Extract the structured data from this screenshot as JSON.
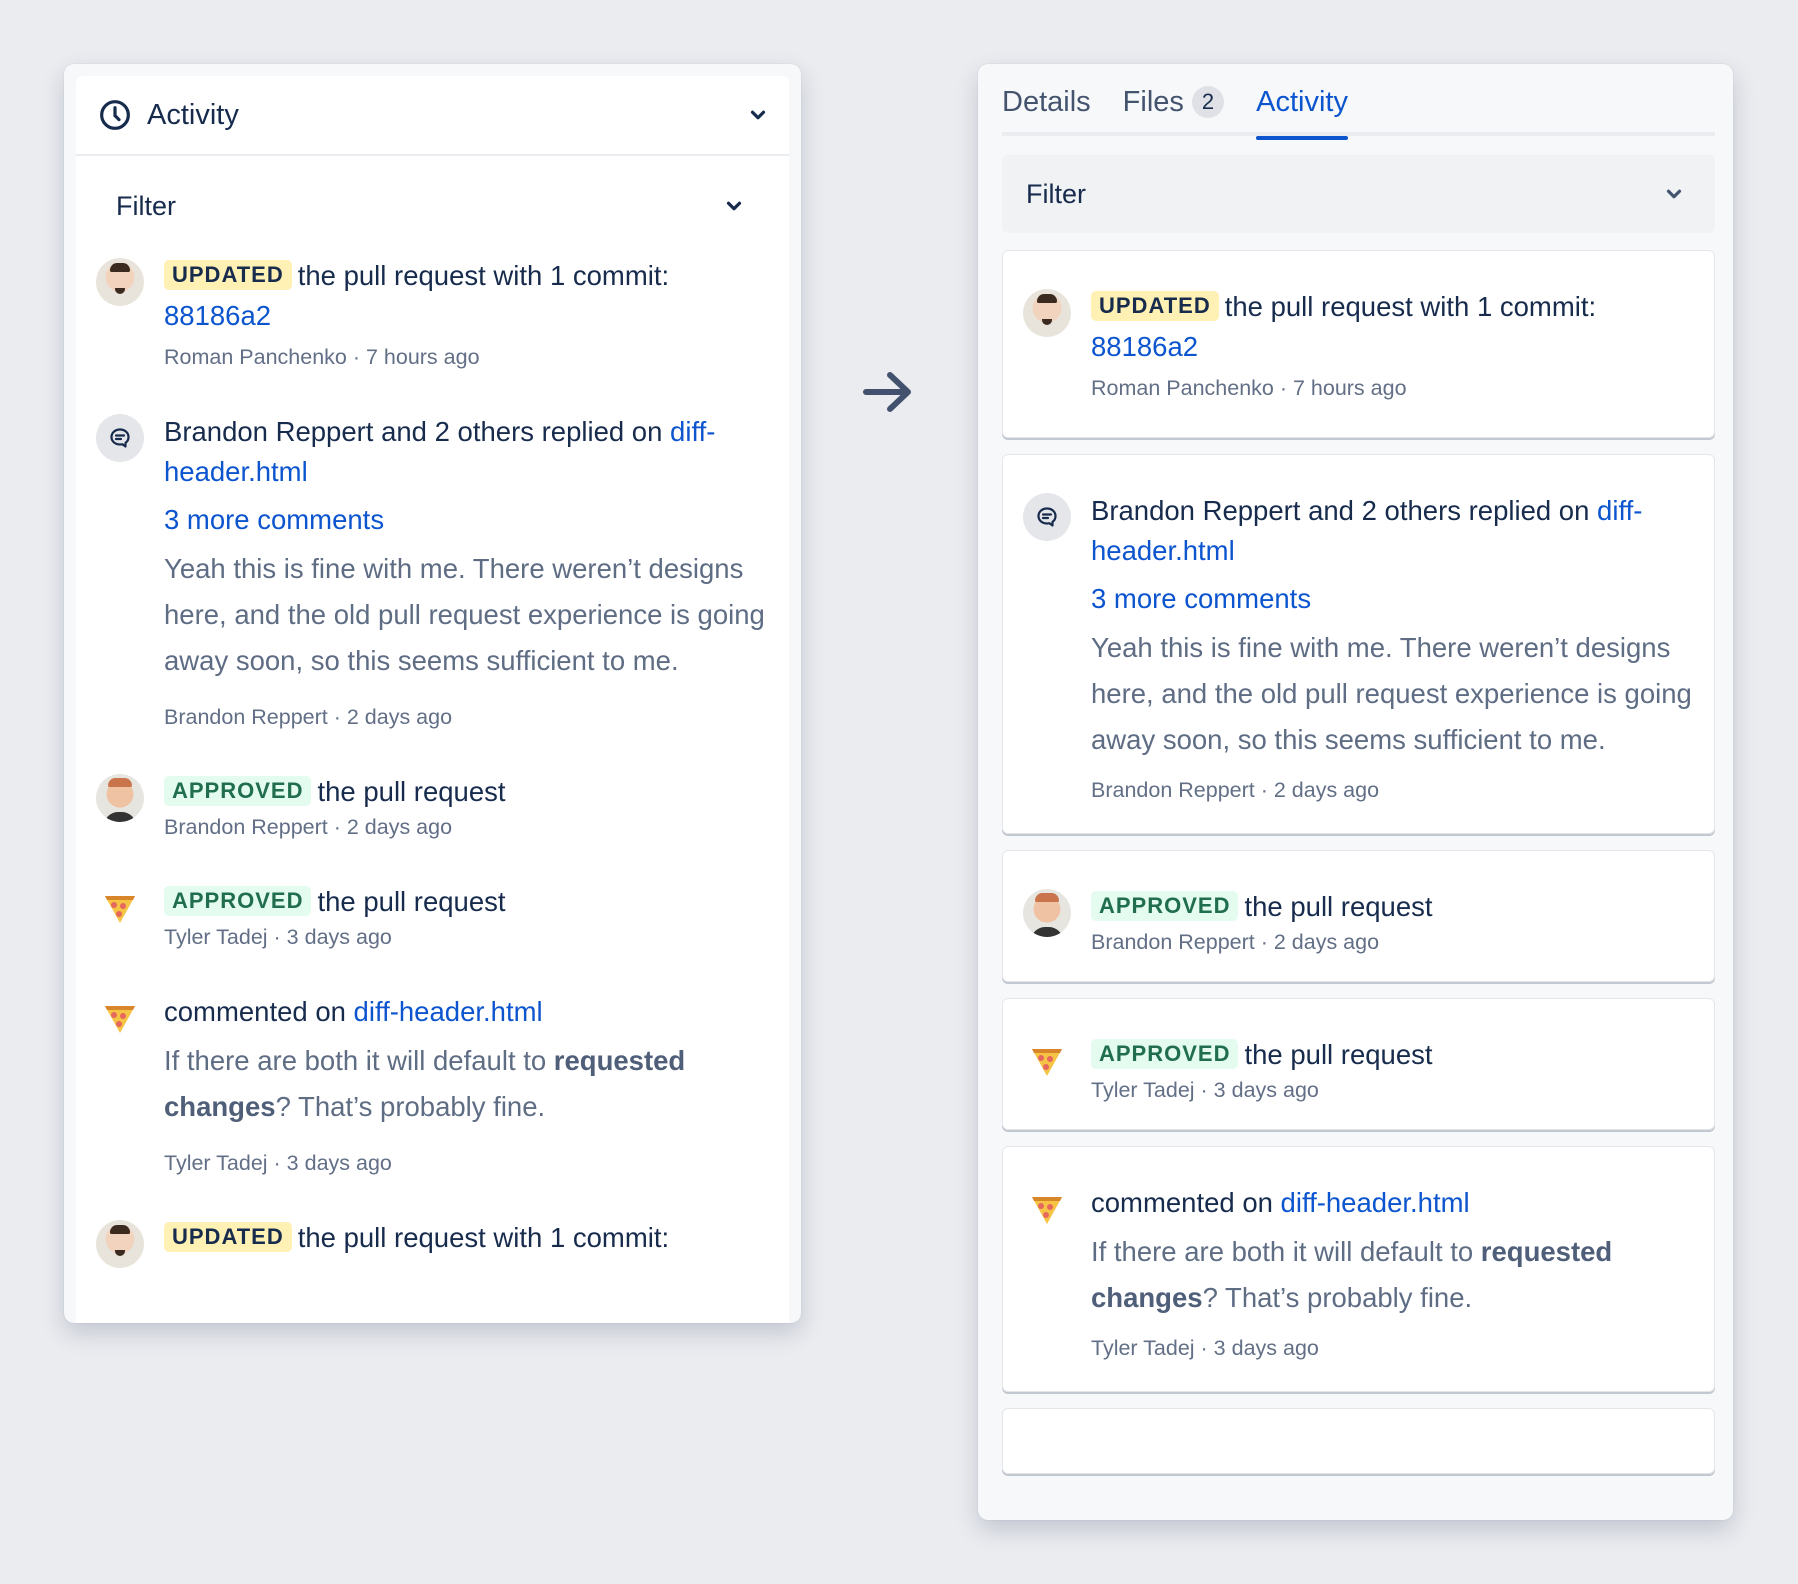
{
  "left_panel": {
    "header_title": "Activity",
    "filter_label": "Filter",
    "entries": [
      {
        "badge": "UPDATED",
        "text": "the pull request with 1 commit:",
        "link": "88186a2",
        "author": "Roman Panchenko",
        "time": "7 hours ago",
        "meta": "Roman Panchenko · 7 hours ago"
      },
      {
        "text": "Brandon Reppert and 2 others replied on ",
        "link": "diff-header.html",
        "more_comments": "3 more comments",
        "body": "Yeah this is fine with me. There weren’t designs here, and the old pull request experience is going away soon, so this seems sufficient to me.",
        "meta": "Brandon Reppert · 2 days ago"
      },
      {
        "badge": "APPROVED",
        "text": "the pull request",
        "meta": "Brandon Reppert · 2 days ago"
      },
      {
        "badge": "APPROVED",
        "text": "the pull request",
        "meta": "Tyler Tadej · 3 days ago"
      },
      {
        "text": "commented on ",
        "link": "diff-header.html",
        "body_before": "If there are both it will default to ",
        "body_bold1": "requested",
        "body_mid": " ",
        "body_bold2": "changes",
        "body_after": "? That’s probably fine.",
        "meta": "Tyler Tadej · 3 days ago"
      },
      {
        "badge": "UPDATED",
        "text": "the pull request with 1 commit:"
      }
    ]
  },
  "right_panel": {
    "tabs": [
      {
        "label": "Details"
      },
      {
        "label": "Files",
        "count": "2"
      },
      {
        "label": "Activity",
        "active": true
      }
    ],
    "filter_label": "Filter"
  },
  "icons": {
    "header": "clock-icon",
    "chevron": "chevron-down-icon",
    "comment": "comment-bubble-icon",
    "pizza": "pizza-avatar-icon",
    "transition": "arrow-right-icon"
  },
  "colors": {
    "link": "#0c55cf",
    "text": "#172b4d",
    "meta": "#626f86",
    "updated_badge_bg": "#fff0b3",
    "approved_badge_bg": "#e3fcef",
    "approved_badge_text": "#216e4e",
    "background": "#ebecf0"
  }
}
